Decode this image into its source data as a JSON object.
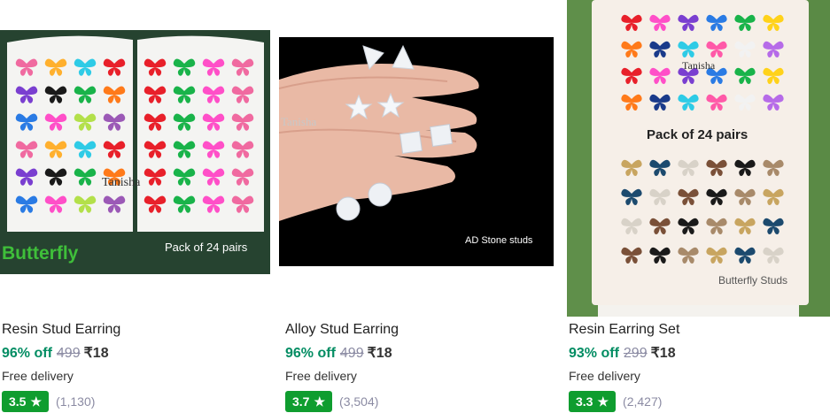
{
  "products": [
    {
      "image_caption_main": "Butterfly",
      "image_caption_pack": "Pack of 24 pairs",
      "image_watermark": "Tanisha",
      "title": "Resin Stud Earring",
      "discount": "96% off",
      "original_price": "499",
      "price": "₹18",
      "delivery": "Free delivery",
      "rating": "3.5",
      "rating_count": "(1,130)"
    },
    {
      "image_caption_main": "AD Stone studs",
      "image_watermark": "Tanisha",
      "title": "Alloy Stud Earring",
      "discount": "96% off",
      "original_price": "499",
      "price": "₹18",
      "delivery": "Free delivery",
      "rating": "3.7",
      "rating_count": "(3,504)"
    },
    {
      "image_caption_main": "Pack of 24 pairs",
      "image_caption_bottom": "Butterfly Studs",
      "image_watermark": "Tanisha",
      "title": "Resin Earring Set",
      "discount": "93% off",
      "original_price": "299",
      "price": "₹18",
      "delivery": "Free delivery",
      "rating": "3.3",
      "rating_count": "(2,427)"
    }
  ],
  "colors": {
    "discount": "#038d63",
    "rating_badge": "#0f9d2f",
    "muted": "#8b8ba3"
  }
}
